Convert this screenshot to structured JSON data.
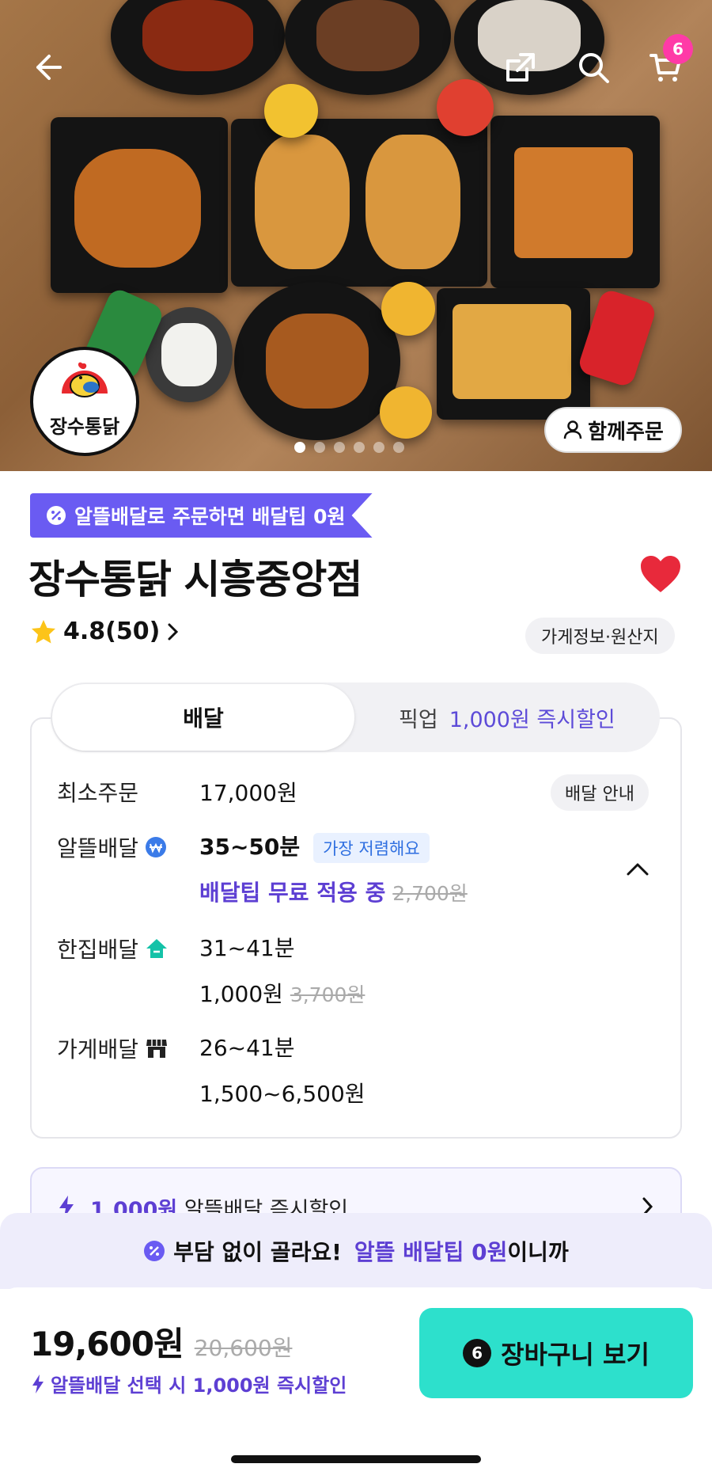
{
  "header": {
    "cart_count": "6",
    "icons": [
      "back-arrow-icon",
      "share-icon",
      "search-icon",
      "cart-icon"
    ]
  },
  "hero": {
    "logo_text": "장수통닭",
    "together_order": "함께주문",
    "carousel": {
      "total": 6,
      "active": 1
    }
  },
  "store": {
    "promo_tag": "알뜰배달로 주문하면 배달팁 0원",
    "name": "장수통닭 시흥중앙점",
    "rating": "4.8(50)",
    "info_chip": "가게정보·원산지",
    "favorite_color": "#e8293b"
  },
  "tabs": {
    "delivery": "배달",
    "pickup": "픽업",
    "pickup_discount": "1,000원 즉시할인"
  },
  "delivery_info": {
    "min_order_label": "최소주문",
    "min_order_value": "17,000원",
    "guide_chip": "배달 안내",
    "rows": [
      {
        "label": "알뜰배달",
        "time": "35~50분",
        "tag": "가장 저렴해요",
        "fee": "배달팁 무료 적용 중",
        "fee_original": "2,700원"
      },
      {
        "label": "한집배달",
        "time": "31~41분",
        "fee": "1,000원",
        "fee_original": "3,700원"
      },
      {
        "label": "가게배달",
        "time": "26~41분",
        "fee": "1,500~6,500원"
      }
    ]
  },
  "discount_banner": {
    "amount": "1,000원",
    "text": "알뜰배달 즉시할인"
  },
  "notice": {
    "pre": "부담 없이 골라요!",
    "highlight": "알뜰 배달팁 0원",
    "post": "이니까"
  },
  "bottom": {
    "price": "19,600원",
    "price_original": "20,600원",
    "price_note": "알뜰배달 선택 시 1,000원 즉시할인",
    "cart_count": "6",
    "cart_button": "장바구니 보기"
  },
  "colors": {
    "accent_purple": "#5d3fd3",
    "tag_purple": "#6a5bf2",
    "mint": "#2de0cc",
    "badge_pink": "#ff3aa7"
  }
}
